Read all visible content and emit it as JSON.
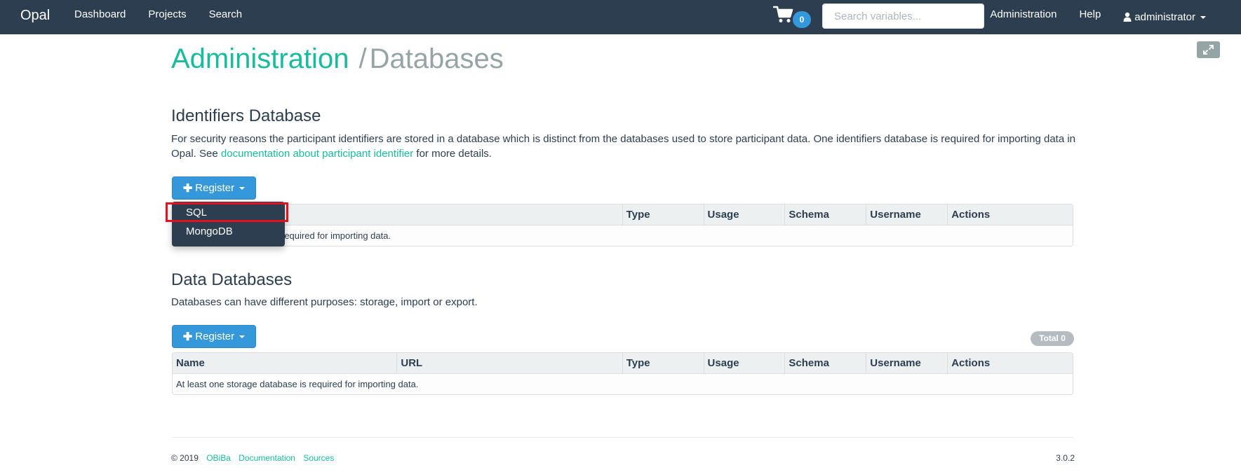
{
  "navbar": {
    "brand": "Opal",
    "links": [
      "Dashboard",
      "Projects",
      "Search"
    ],
    "cart_count": "0",
    "search_placeholder": "Search variables...",
    "right_links": [
      "Administration",
      "Help"
    ],
    "user": "administrator",
    "icons": {
      "cart": "shopping-cart-icon",
      "user": "user-icon"
    }
  },
  "page": {
    "title": "Administration",
    "separator": "/",
    "subtitle": "Databases",
    "expand_icon": "expand-icon"
  },
  "identifiers": {
    "heading": "Identifiers Database",
    "desc_part1": "For security reasons the participant identifiers are stored in a database which is distinct from the databases used to store participant data. One identifiers database is required for importing data in Opal. See ",
    "desc_link": "documentation about participant identifier",
    "desc_part2": " for more details.",
    "register_button": "Register",
    "columns": [
      "",
      "Type",
      "Usage",
      "Schema",
      "Username",
      "Actions"
    ],
    "empty_message": "required for importing data."
  },
  "dropdown": {
    "items": [
      "SQL",
      "MongoDB"
    ]
  },
  "data_databases": {
    "heading": "Data Databases",
    "desc": "Databases can have different purposes: storage, import or export.",
    "register_button": "Register",
    "total_badge": "Total 0",
    "columns": [
      "Name",
      "URL",
      "Type",
      "Usage",
      "Schema",
      "Username",
      "Actions"
    ],
    "empty_message": "At least one storage database is required for importing data."
  },
  "footer": {
    "copyright": "© 2019",
    "links": [
      "OBiBa",
      "Documentation",
      "Sources"
    ],
    "version": "3.0.2"
  },
  "colors": {
    "navbar": "#2c3e50",
    "accent_green": "#18bc9c",
    "primary_blue": "#3498db",
    "muted_gray": "#95a5a6",
    "highlight_red": "#e0141e"
  }
}
